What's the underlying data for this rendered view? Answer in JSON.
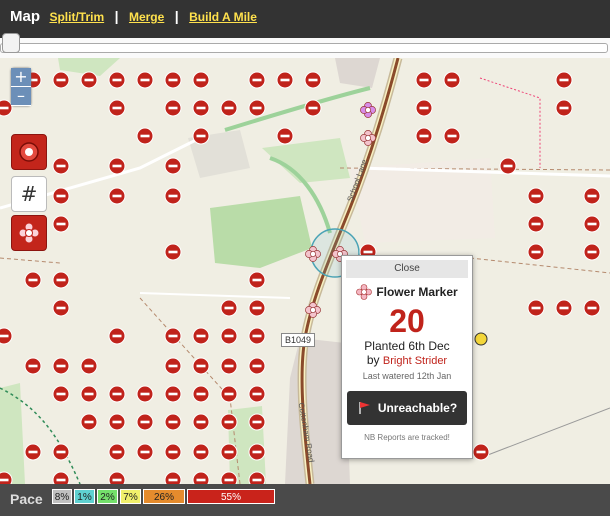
{
  "toolbar": {
    "title": "Map",
    "links": [
      "Split/Trim",
      "Merge",
      "Build A Mile"
    ]
  },
  "map": {
    "zoom_in": "+",
    "zoom_out": "–",
    "road_label": "B1049",
    "street_labels": [
      "Cottenham Road",
      "School Lane"
    ]
  },
  "popup": {
    "close": "Close",
    "title": "Flower Marker",
    "count": "20",
    "planted": "Planted 6th Dec",
    "by_prefix": "by",
    "user": "Bright Strider",
    "watered": "Last watered 12th Jan",
    "button": "Unreachable?",
    "note": "NB Reports are tracked!"
  },
  "pace": {
    "label": "Pace",
    "segments": [
      {
        "label": "8%",
        "color": "#c0c0c0"
      },
      {
        "label": "1%",
        "color": "#5fd1d1"
      },
      {
        "label": "2%",
        "color": "#74e06b"
      },
      {
        "label": "7%",
        "color": "#f1f06b"
      },
      {
        "label": "26%",
        "color": "#e58b2d"
      },
      {
        "label": "55%",
        "color": "#c9231b"
      }
    ]
  },
  "colors": {
    "marker_red": "#c0231b",
    "accent_link": "#ffe14d",
    "topbar": "#333333"
  },
  "icons": {
    "tool1": "red-marker-icon",
    "tool2": "grid-icon",
    "tool3": "flower-icon",
    "popup_button": "flag-icon"
  }
}
